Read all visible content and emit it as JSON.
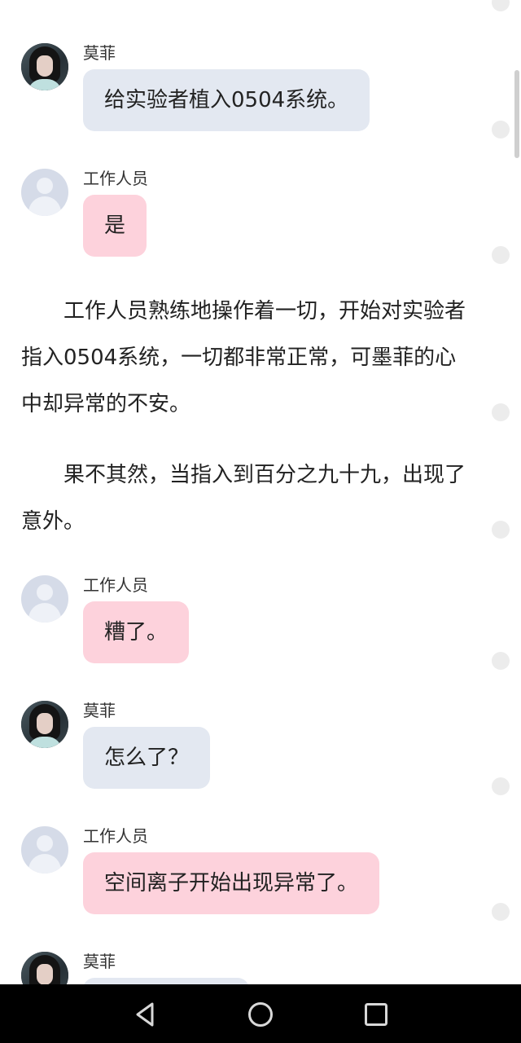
{
  "top_fragment": "",
  "messages": [
    {
      "sender": "莫菲",
      "text": "给实验者植入0504系统。"
    },
    {
      "sender": "工作人员",
      "text": "是"
    },
    {
      "sender": "工作人员",
      "text": "糟了。"
    },
    {
      "sender": "莫菲",
      "text": "怎么了？"
    },
    {
      "sender": "工作人员",
      "text": "空间离子开始出现异常了。"
    },
    {
      "sender": "莫菲",
      "text": ""
    }
  ],
  "paragraphs": [
    "工作人员熟练地操作着一切，开始对实验者指入0504系统，一切都非常正常，可墨菲的心中却异常的不安。",
    "果不其然，当指入到百分之九十九，出现了意外。"
  ],
  "colors": {
    "bubble_gray": "#e3e8f1",
    "bubble_pink": "#fdd2dc",
    "background": "#ffffff",
    "navbar": "#000000"
  },
  "icons": {
    "side_dots": "dot-icon",
    "nav_back": "back-triangle-icon",
    "nav_home": "home-circle-icon",
    "nav_recents": "recents-square-icon"
  }
}
